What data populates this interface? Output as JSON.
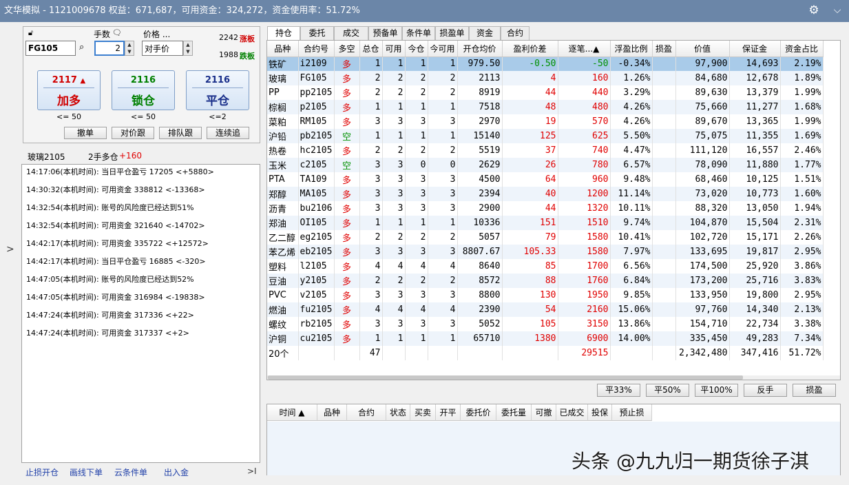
{
  "titlebar": {
    "title": "文华模拟 - 1121009678  权益：671,687，可用资金：324,272，资金使用率：51.72%",
    "gear_icon": "gear-icon",
    "close_icon": "chevron-down-icon"
  },
  "order_panel": {
    "contract": "FG105",
    "qty_label": "手数",
    "qty_value": "2",
    "price_label": "价格 ...",
    "price_value": "对手价",
    "upper_limit": "2242",
    "upper_limit_label": "涨板",
    "lower_limit": "1988",
    "lower_limit_label": "跌板",
    "buttons": [
      {
        "price": "2117",
        "arrow": "▲",
        "label": "加多",
        "sub": "<= 50"
      },
      {
        "price": "2116",
        "arrow": "",
        "label": "锁仓",
        "sub": "<= 50"
      },
      {
        "price": "2116",
        "arrow": "",
        "label": "平仓",
        "sub": "<=2"
      }
    ],
    "small_buttons": [
      "撤单",
      "对价跟",
      "排队跟",
      "连续追"
    ],
    "position_name": "玻璃2105",
    "position_desc": "2手多仓",
    "position_pnl": "+160"
  },
  "log": [
    "14:17:06(本机时间): 当日平仓盈亏 17205  <+5880>",
    "14:30:32(本机时间): 可用资金 338812  <-13368>",
    "14:32:54(本机时间): 账号的风险度已经达到51%",
    "14:32:54(本机时间): 可用资金 321640  <-14702>",
    "14:42:17(本机时间): 可用资金 335722  <+12572>",
    "14:42:17(本机时间): 当日平仓盈亏 16885  <-320>",
    "14:47:05(本机时间): 账号的风险度已经达到52%",
    "14:47:05(本机时间): 可用资金 316984  <-19838>",
    "14:47:24(本机时间): 可用资金 317336  <+22>",
    "14:47:24(本机时间): 可用资金 317337  <+2>"
  ],
  "bottom_links": [
    "止损开仓",
    "画线下单",
    "云条件单",
    "出入金"
  ],
  "bottom_collapse": ">I",
  "side_arrow": ">",
  "tabs": [
    "持仓",
    "委托",
    "成交",
    "预备单",
    "条件单",
    "损盈单",
    "资金",
    "合约"
  ],
  "grid": {
    "headers": [
      "品种",
      "合约号",
      "多空",
      "总仓",
      "可用",
      "今仓",
      "今可用",
      "开仓均价",
      "盈利价差",
      "逐笔...▲",
      "浮盈比例",
      "损盈",
      "价值",
      "保证金",
      "资金占比"
    ],
    "rows": [
      [
        "铁矿",
        "i2109",
        "多",
        "1",
        "1",
        "1",
        "1",
        "979.50",
        "-0.50",
        "-50",
        "-0.34%",
        "",
        "97,900",
        "14,693",
        "2.19%"
      ],
      [
        "玻璃",
        "FG105",
        "多",
        "2",
        "2",
        "2",
        "2",
        "2113",
        "4",
        "160",
        "1.26%",
        "",
        "84,680",
        "12,678",
        "1.89%"
      ],
      [
        "PP",
        "pp2105",
        "多",
        "2",
        "2",
        "2",
        "2",
        "8919",
        "44",
        "440",
        "3.29%",
        "",
        "89,630",
        "13,379",
        "1.99%"
      ],
      [
        "棕榈",
        "p2105",
        "多",
        "1",
        "1",
        "1",
        "1",
        "7518",
        "48",
        "480",
        "4.26%",
        "",
        "75,660",
        "11,277",
        "1.68%"
      ],
      [
        "菜粕",
        "RM105",
        "多",
        "3",
        "3",
        "3",
        "3",
        "2970",
        "19",
        "570",
        "4.26%",
        "",
        "89,670",
        "13,365",
        "1.99%"
      ],
      [
        "沪铅",
        "pb2105",
        "空",
        "1",
        "1",
        "1",
        "1",
        "15140",
        "125",
        "625",
        "5.50%",
        "",
        "75,075",
        "11,355",
        "1.69%"
      ],
      [
        "热卷",
        "hc2105",
        "多",
        "2",
        "2",
        "2",
        "2",
        "5519",
        "37",
        "740",
        "4.47%",
        "",
        "111,120",
        "16,557",
        "2.46%"
      ],
      [
        "玉米",
        "c2105",
        "空",
        "3",
        "3",
        "0",
        "0",
        "2629",
        "26",
        "780",
        "6.57%",
        "",
        "78,090",
        "11,880",
        "1.77%"
      ],
      [
        "PTA",
        "TA109",
        "多",
        "3",
        "3",
        "3",
        "3",
        "4500",
        "64",
        "960",
        "9.48%",
        "",
        "68,460",
        "10,125",
        "1.51%"
      ],
      [
        "郑醇",
        "MA105",
        "多",
        "3",
        "3",
        "3",
        "3",
        "2394",
        "40",
        "1200",
        "11.14%",
        "",
        "73,020",
        "10,773",
        "1.60%"
      ],
      [
        "沥青",
        "bu2106",
        "多",
        "3",
        "3",
        "3",
        "3",
        "2900",
        "44",
        "1320",
        "10.11%",
        "",
        "88,320",
        "13,050",
        "1.94%"
      ],
      [
        "郑油",
        "OI105",
        "多",
        "1",
        "1",
        "1",
        "1",
        "10336",
        "151",
        "1510",
        "9.74%",
        "",
        "104,870",
        "15,504",
        "2.31%"
      ],
      [
        "乙二醇",
        "eg2105",
        "多",
        "2",
        "2",
        "2",
        "2",
        "5057",
        "79",
        "1580",
        "10.41%",
        "",
        "102,720",
        "15,171",
        "2.26%"
      ],
      [
        "苯乙烯",
        "eb2105",
        "多",
        "3",
        "3",
        "3",
        "3",
        "8807.67",
        "105.33",
        "1580",
        "7.97%",
        "",
        "133,695",
        "19,817",
        "2.95%"
      ],
      [
        "塑料",
        "l2105",
        "多",
        "4",
        "4",
        "4",
        "4",
        "8640",
        "85",
        "1700",
        "6.56%",
        "",
        "174,500",
        "25,920",
        "3.86%"
      ],
      [
        "豆油",
        "y2105",
        "多",
        "2",
        "2",
        "2",
        "2",
        "8572",
        "88",
        "1760",
        "6.84%",
        "",
        "173,200",
        "25,716",
        "3.83%"
      ],
      [
        "PVC",
        "v2105",
        "多",
        "3",
        "3",
        "3",
        "3",
        "8800",
        "130",
        "1950",
        "9.85%",
        "",
        "133,950",
        "19,800",
        "2.95%"
      ],
      [
        "燃油",
        "fu2105",
        "多",
        "4",
        "4",
        "4",
        "4",
        "2390",
        "54",
        "2160",
        "15.06%",
        "",
        "97,760",
        "14,340",
        "2.13%"
      ],
      [
        "螺纹",
        "rb2105",
        "多",
        "3",
        "3",
        "3",
        "3",
        "5052",
        "105",
        "3150",
        "13.86%",
        "",
        "154,710",
        "22,734",
        "3.38%"
      ],
      [
        "沪铜",
        "cu2105",
        "多",
        "1",
        "1",
        "1",
        "1",
        "65710",
        "1380",
        "6900",
        "14.00%",
        "",
        "335,450",
        "49,283",
        "7.34%"
      ]
    ],
    "summary": [
      "20个",
      "",
      "",
      "47",
      "",
      "",
      "",
      "",
      "",
      "29515",
      "",
      "",
      "2,342,480",
      "347,416",
      "51.72%"
    ]
  },
  "action_buttons": [
    "平33%",
    "平50%",
    "平100%",
    "反手",
    "损盈"
  ],
  "order_headers": [
    "时间 ▲",
    "品种",
    "合约",
    "状态",
    "买卖",
    "开平",
    "委托价",
    "委托量",
    "可撤",
    "已成交",
    "投保",
    "预止损"
  ],
  "watermark": "头条 @九九归一期货徐子淇",
  "colors": {
    "titlebar": "#6b86a8",
    "profit": "#e00000",
    "loss": "#009000",
    "selected_row": "#a9cbe9"
  }
}
